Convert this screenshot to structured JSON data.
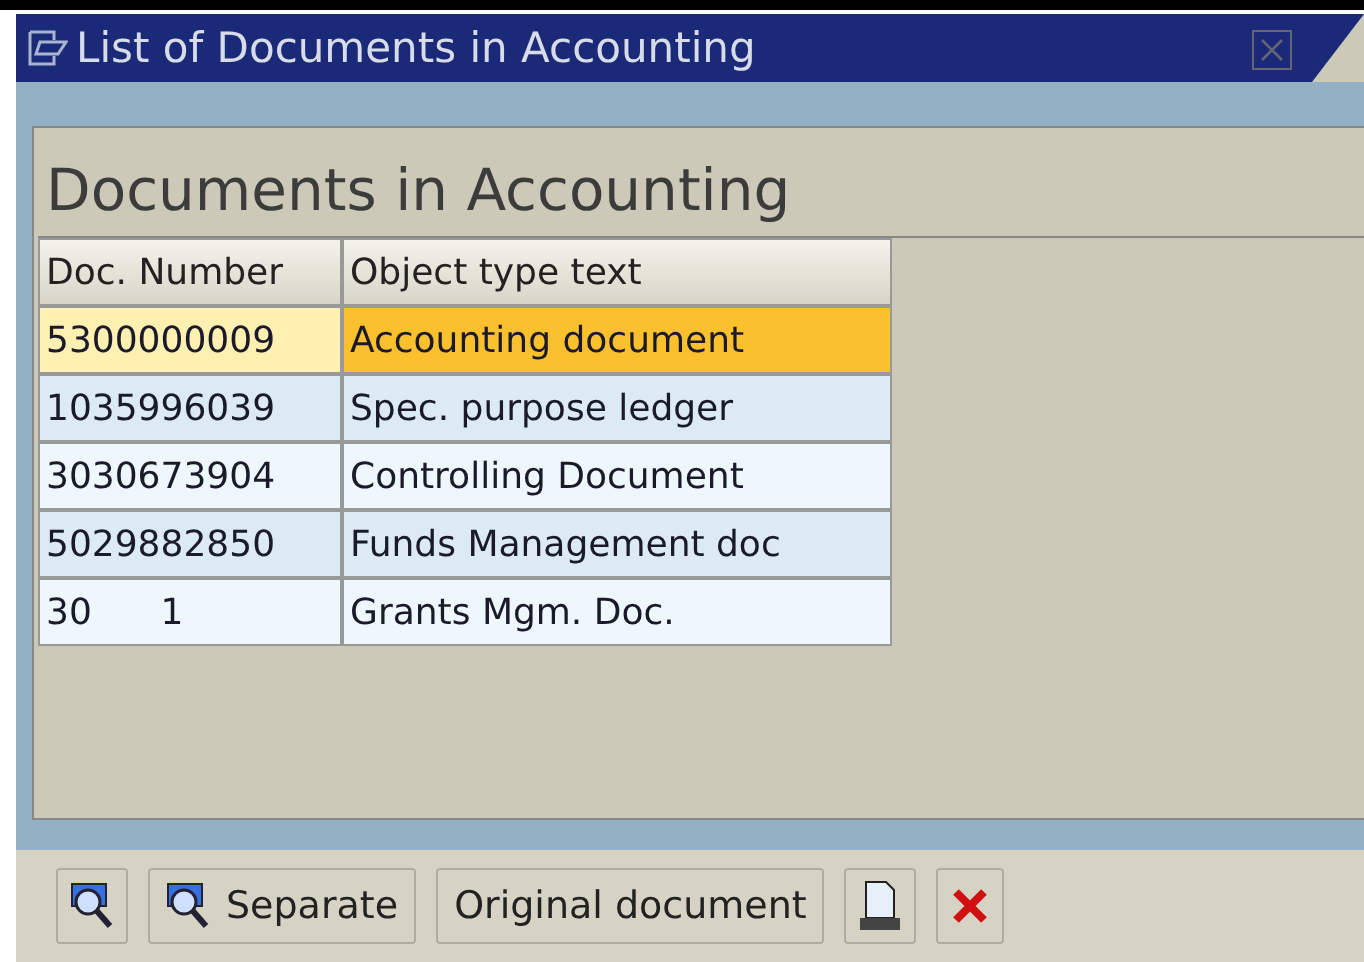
{
  "window": {
    "title": "List of Documents in Accounting"
  },
  "heading": "Documents in Accounting",
  "table": {
    "columns": [
      "Doc. Number",
      "Object type text"
    ],
    "rows": [
      {
        "cells": [
          "5300000009",
          "Accounting document"
        ],
        "selected": true
      },
      {
        "cells": [
          "1035996039",
          "Spec. purpose ledger"
        ],
        "selected": false
      },
      {
        "cells": [
          "3030673904",
          "Controlling Document"
        ],
        "selected": false
      },
      {
        "cells": [
          "5029882850",
          "Funds Management doc"
        ],
        "selected": false
      },
      {
        "cells": [
          "30      1",
          "Grants Mgm. Doc."
        ],
        "selected": false
      }
    ]
  },
  "toolbar": [
    {
      "kind": "detail"
    },
    {
      "kind": "detail",
      "label": "Separate"
    },
    {
      "kind": "text",
      "label": "Original document"
    },
    {
      "kind": "print"
    },
    {
      "kind": "cancel"
    }
  ]
}
